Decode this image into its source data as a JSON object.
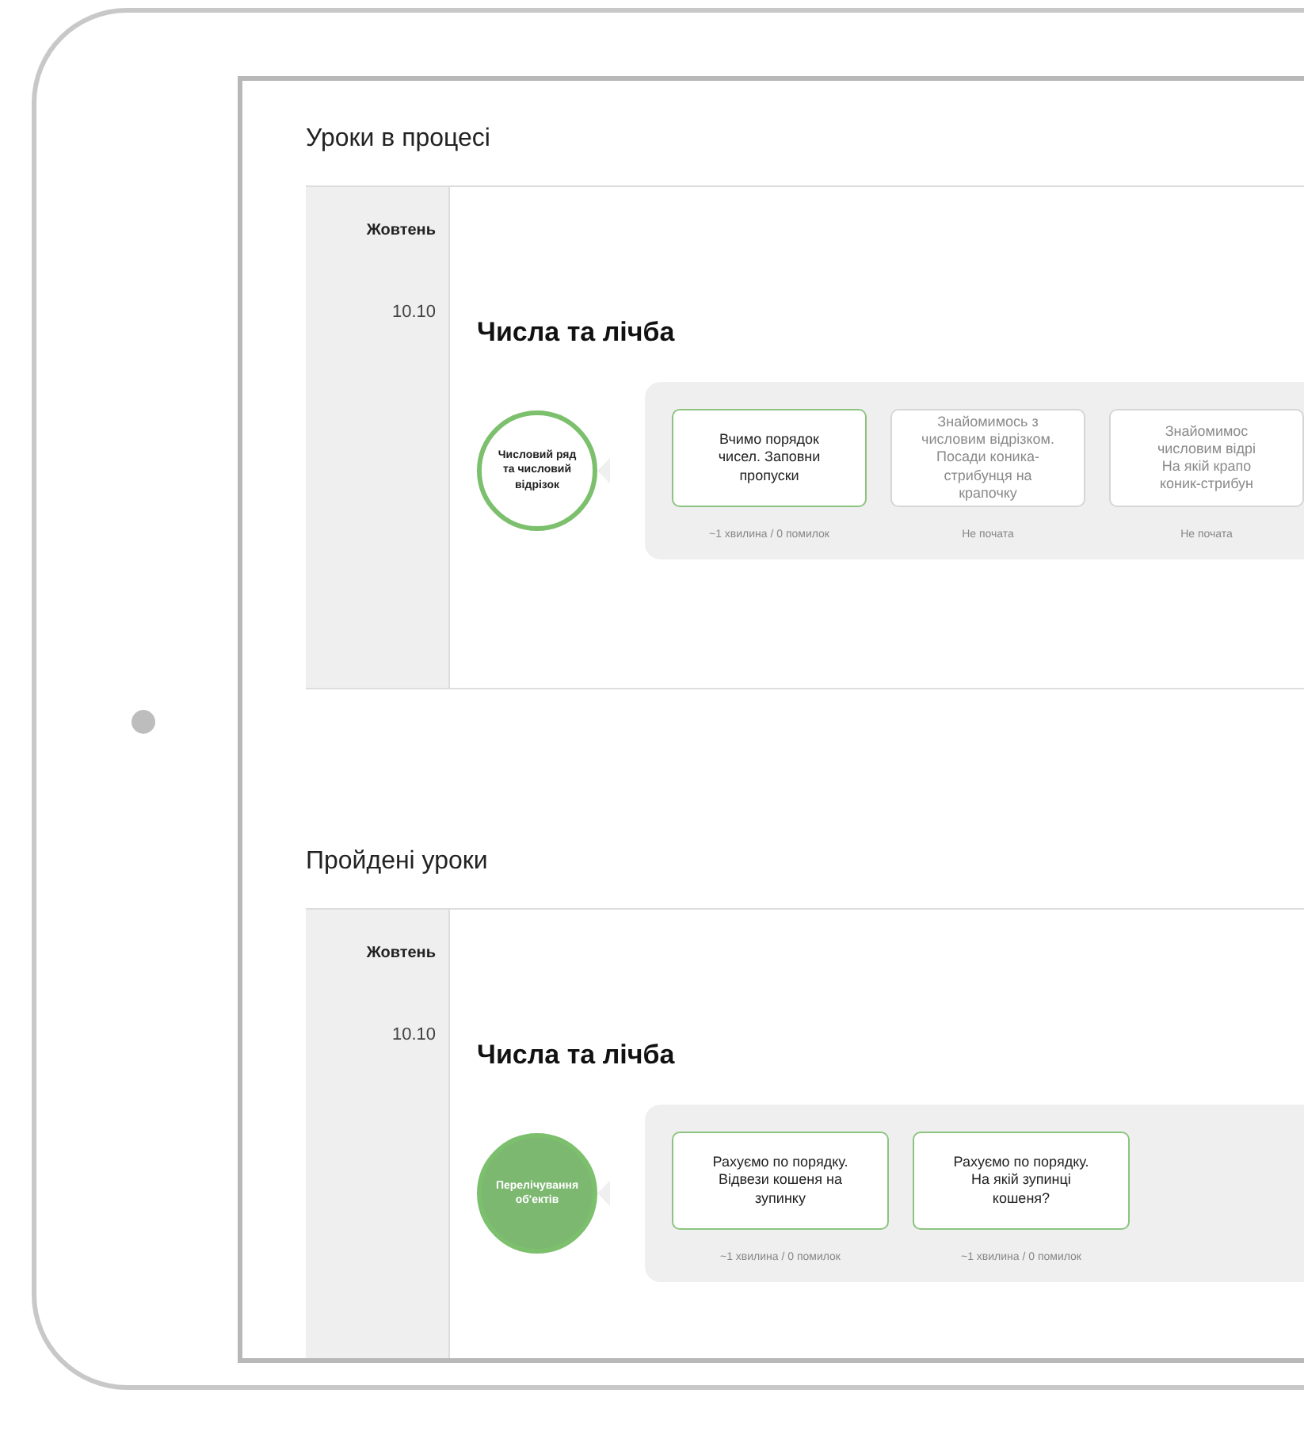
{
  "sections": [
    {
      "title": "Уроки в процесі",
      "month": "Жовтень",
      "date": "10.10",
      "topic": "Числа та лічба",
      "skill": {
        "label": "Числовий ряд та числовий відрізок",
        "filled": false
      },
      "lessons": [
        {
          "lines": [
            "Вчимо порядок",
            "чисел. Заповни",
            "пропуски"
          ],
          "started": true,
          "note": "~1 хвилина / 0 помилок"
        },
        {
          "lines": [
            "Знайомимось з",
            "числовим відрізком.",
            "Посади коника-",
            "стрибунця на",
            "крапочку"
          ],
          "started": false,
          "note": "Не почата"
        },
        {
          "lines": [
            "Знайомимос",
            "числовим відрі",
            "На якій крапо",
            "коник-стрибун"
          ],
          "started": false,
          "note": "Не почата"
        }
      ]
    },
    {
      "title": "Пройдені уроки",
      "month": "Жовтень",
      "date": "10.10",
      "topic": "Числа та лічба",
      "skill": {
        "label": "Перелічування об'ектів",
        "filled": true
      },
      "lessons": [
        {
          "lines": [
            "Рахуємо по порядку.",
            "Відвези кошеня на",
            "зупинку"
          ],
          "started": true,
          "note": "~1 хвилина / 0 помилок"
        },
        {
          "lines": [
            "Рахуємо по порядку.",
            "На якій зупинці",
            "кошеня?"
          ],
          "started": true,
          "note": "~1 хвилина / 0 помилок"
        }
      ]
    }
  ]
}
